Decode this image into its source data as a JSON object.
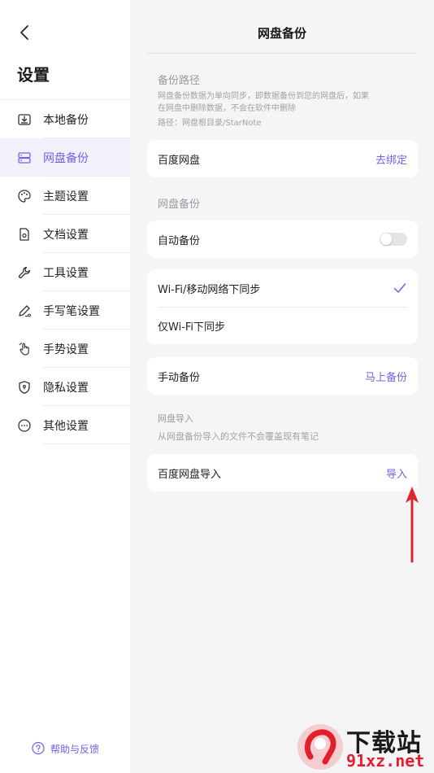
{
  "sidebar": {
    "title": "设置",
    "items": [
      {
        "label": "本地备份",
        "icon": "local-backup-icon"
      },
      {
        "label": "网盘备份",
        "icon": "cloud-drive-icon",
        "active": true
      },
      {
        "label": "主题设置",
        "icon": "palette-icon"
      },
      {
        "label": "文档设置",
        "icon": "document-settings-icon"
      },
      {
        "label": "工具设置",
        "icon": "wrench-icon"
      },
      {
        "label": "手写笔设置",
        "icon": "pen-icon"
      },
      {
        "label": "手势设置",
        "icon": "hand-gesture-icon"
      },
      {
        "label": "隐私设置",
        "icon": "shield-icon"
      },
      {
        "label": "其他设置",
        "icon": "more-icon"
      }
    ],
    "help_label": "帮助与反馈"
  },
  "main": {
    "title": "网盘备份",
    "backup_path": {
      "title": "备份路径",
      "desc_line1": "网盘备份数据为单向同步，即数据备份到您的网盘后，如果",
      "desc_line2": "在网盘中删除数据，不会在软件中删除",
      "path": "路径：网盘根目录/StarNote"
    },
    "baidu": {
      "label": "百度网盘",
      "action": "去绑定"
    },
    "cloud_backup_title": "网盘备份",
    "auto_backup": {
      "label": "自动备份",
      "enabled": false
    },
    "sync_options": [
      {
        "label": "Wi-Fi/移动网络下同步",
        "selected": true
      },
      {
        "label": "仅Wi-Fi下同步",
        "selected": false
      }
    ],
    "manual_backup": {
      "label": "手动备份",
      "action": "马上备份"
    },
    "import": {
      "title": "网盘导入",
      "desc": "从网盘备份导入的文件不会覆盖现有笔记",
      "label": "百度网盘导入",
      "action": "导入"
    }
  },
  "watermark": {
    "text1": "下载站",
    "text2": "91xz.net"
  },
  "colors": {
    "accent": "#6f63e6",
    "annotation": "#e0242b"
  }
}
